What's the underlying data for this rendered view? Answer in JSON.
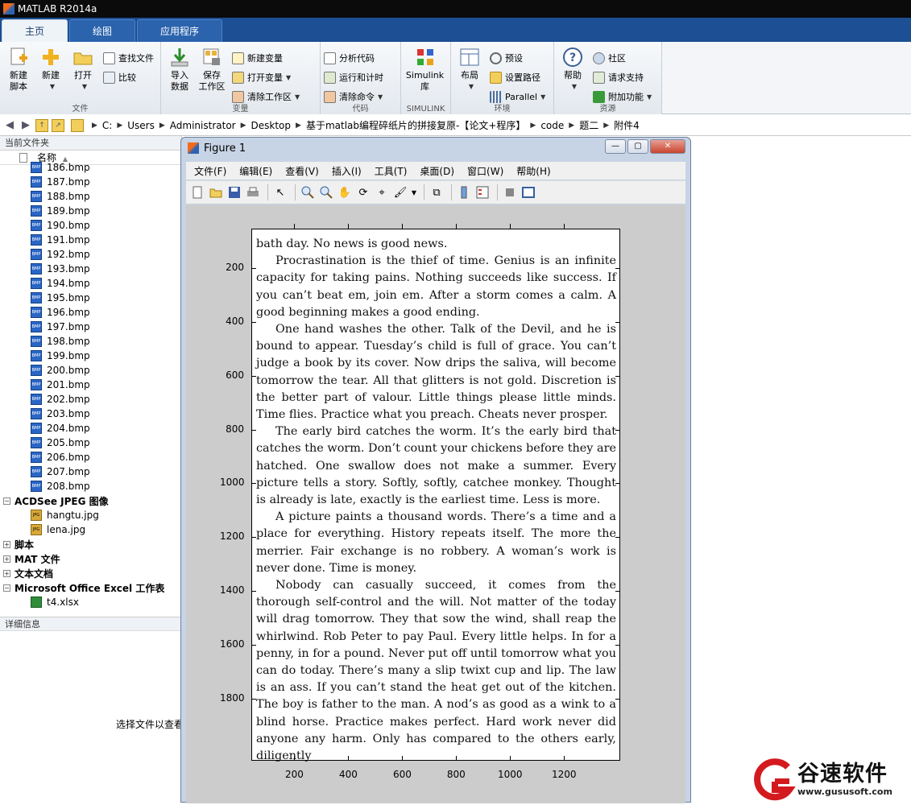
{
  "app": {
    "title": "MATLAB R2014a"
  },
  "tabs": [
    {
      "label": "主页"
    },
    {
      "label": "绘图"
    },
    {
      "label": "应用程序"
    }
  ],
  "ribbon": {
    "file": {
      "label": "文件",
      "new_script": [
        "新建",
        "脚本"
      ],
      "new": "新建",
      "open": "打开",
      "find_files": "查找文件",
      "compare": "比较"
    },
    "variable": {
      "label": "变量",
      "import": [
        "导入",
        "数据"
      ],
      "save_workspace": [
        "保存",
        "工作区"
      ],
      "new_variable": "新建变量",
      "open_variable": "打开变量",
      "clear_workspace": "清除工作区"
    },
    "code": {
      "label": "代码",
      "analyze": "分析代码",
      "run_time": "运行和计时",
      "clear_commands": "清除命令"
    },
    "simulink": {
      "label": "SIMULINK",
      "library": [
        "Simulink",
        "库"
      ]
    },
    "environment": {
      "label": "环境",
      "layout": "布局",
      "preferences": "预设",
      "set_path": "设置路径",
      "parallel": "Parallel"
    },
    "resources": {
      "label": "资源",
      "help": "帮助",
      "community": "社区",
      "request_support": "请求支持",
      "addons": "附加功能"
    }
  },
  "address": {
    "crumbs": [
      "C:",
      "Users",
      "Administrator",
      "Desktop",
      "基于matlab编程碎纸片的拼接复原-【论文+程序】",
      "code",
      "题二",
      "附件4"
    ]
  },
  "current_folder": {
    "title": "当前文件夹",
    "column_name": "名称",
    "bmp_files": [
      "186.bmp",
      "187.bmp",
      "188.bmp",
      "189.bmp",
      "190.bmp",
      "191.bmp",
      "192.bmp",
      "193.bmp",
      "194.bmp",
      "195.bmp",
      "196.bmp",
      "197.bmp",
      "198.bmp",
      "199.bmp",
      "200.bmp",
      "201.bmp",
      "202.bmp",
      "203.bmp",
      "204.bmp",
      "205.bmp",
      "206.bmp",
      "207.bmp",
      "208.bmp"
    ],
    "jpeg_group": "ACDSee JPEG 图像",
    "jpeg_files": [
      "hangtu.jpg",
      "lena.jpg"
    ],
    "groups_collapsed": [
      "脚本",
      "MAT 文件",
      "文本文档"
    ],
    "excel_group": "Microsoft Office Excel 工作表",
    "excel_files": [
      "t4.xlsx"
    ],
    "icon_bmp": "BMP",
    "icon_jpg": "JPG",
    "details_title": "详细信息",
    "details_message": "选择文件以查看"
  },
  "figure": {
    "title": "Figure 1",
    "menu": [
      "文件(F)",
      "编辑(E)",
      "查看(V)",
      "插入(I)",
      "工具(T)",
      "桌面(D)",
      "窗口(W)",
      "帮助(H)"
    ],
    "min_label": "—",
    "max_label": "▢",
    "close_label": "✕",
    "paragraphs": [
      "bath day. No news is good news.",
      "Procrastination is the thief of time. Genius is an infinite capacity for taking pains. Nothing succeeds like success. If you can’t beat em, join em. After a storm comes a calm. A good beginning makes a good ending.",
      "One hand washes the other. Talk of the Devil, and he is bound to appear. Tuesday’s child is full of grace. You can’t judge a book by its cover. Now drips the saliva, will become tomorrow the tear. All that glitters is not gold. Discretion is the better part of valour. Little things please little minds. Time flies. Practice what you preach. Cheats never prosper.",
      "The early bird catches the worm. It’s the early bird that catches the worm. Don’t count your chickens before they are hatched. One swallow does not make a summer. Every picture tells a story. Softly, softly, catchee monkey. Thought is already is late, exactly is the earliest time. Less is more.",
      "A picture paints a thousand words. There’s a time and a place for everything. History repeats itself. The more the merrier. Fair exchange is no robbery. A woman’s work is never done. Time is money.",
      "Nobody can casually succeed, it comes from the thorough self-control and the will. Not matter of the today will drag tomorrow. They that sow the wind, shall reap the whirlwind. Rob Peter to pay Paul. Every little helps. In for a penny, in for a pound. Never put off until tomorrow what you can do today. There’s many a slip twixt cup and lip. The law is an ass. If you can’t stand the heat get out of the kitchen. The boy is father to the man. A nod’s as good as a wink to a blind horse. Practice makes perfect. Hard work never did anyone any harm. Only has compared to the others early, diligently"
    ],
    "yticks": [
      "200",
      "400",
      "600",
      "800",
      "1000",
      "1200",
      "1400",
      "1600",
      "1800"
    ],
    "xticks": [
      "200",
      "400",
      "600",
      "800",
      "1000",
      "1200"
    ]
  },
  "watermark": {
    "name": "谷速软件",
    "url": "www.gususoft.com"
  }
}
